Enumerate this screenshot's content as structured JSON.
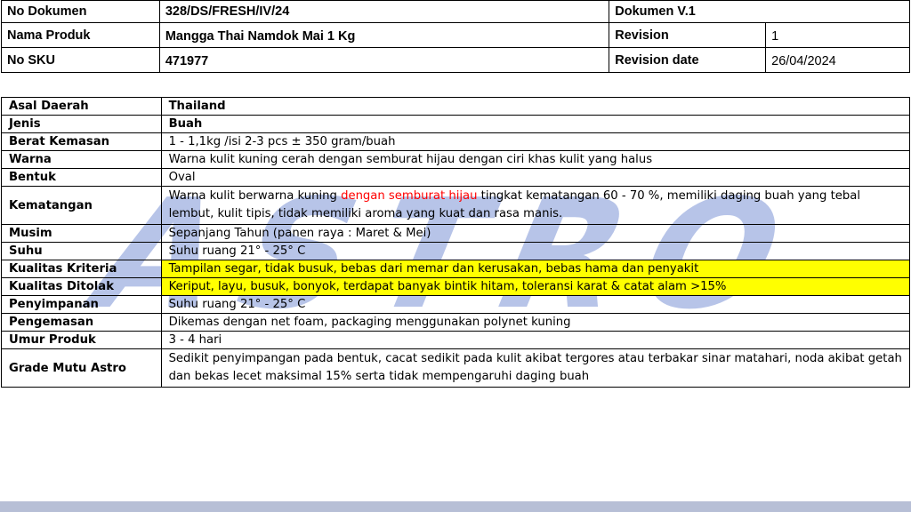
{
  "header": {
    "no_dokumen_label": "No Dokumen",
    "no_dokumen_value": "328/DS/FRESH/IV/24",
    "dokumen_version": "Dokumen V.1",
    "nama_produk_label": "Nama Produk",
    "nama_produk_value": "Mangga Thai Namdok Mai 1 Kg",
    "revision_label": "Revision",
    "revision_value": "1",
    "no_sku_label": "No SKU",
    "no_sku_value": "471977",
    "revision_date_label": "Revision date",
    "revision_date_value": "26/04/2024"
  },
  "spec": {
    "asal_daerah": {
      "label": "Asal Daerah",
      "value": "Thailand"
    },
    "jenis": {
      "label": "Jenis",
      "value": "Buah"
    },
    "berat_kemasan": {
      "label": "Berat Kemasan",
      "value": "1 - 1,1kg /isi 2-3 pcs  ± 350 gram/buah"
    },
    "warna": {
      "label": "Warna",
      "value": "Warna kulit kuning cerah dengan semburat hijau dengan ciri khas kulit yang halus"
    },
    "bentuk": {
      "label": "Bentuk",
      "value": "Oval"
    },
    "kematangan": {
      "label": "Kematangan",
      "value_part1": "Warna kulit berwarna kuning ",
      "value_red": "dengan semburat hijau",
      "value_part2": "  tingkat kematangan 60 - 70 %, memiliki daging buah yang tebal lembut, kulit tipis, tidak memiliki aroma yang kuat dan rasa manis."
    },
    "musim": {
      "label": "Musim",
      "value": "Sepanjang Tahun (panen raya : Maret & Mei)"
    },
    "suhu": {
      "label": "Suhu",
      "value": "Suhu ruang  21° - 25° C"
    },
    "kualitas_kriteria": {
      "label": "Kualitas Kriteria",
      "value": "Tampilan segar, tidak busuk, bebas dari memar dan kerusakan, bebas hama dan penyakit"
    },
    "kualitas_ditolak": {
      "label": "Kualitas Ditolak",
      "value": "Keriput, layu, busuk, bonyok, terdapat banyak bintik hitam, toleransi karat & catat alam >15%"
    },
    "penyimpanan": {
      "label": "Penyimpanan",
      "value": "Suhu ruang  21° - 25° C"
    },
    "pengemasan": {
      "label": "Pengemasan",
      "value": "Dikemas dengan net foam, packaging menggunakan polynet kuning"
    },
    "umur_produk": {
      "label": "Umur Produk",
      "value": "3 - 4 hari"
    },
    "grade_mutu": {
      "label": "Grade Mutu Astro",
      "value": "Sedikit penyimpangan pada bentuk, cacat sedikit pada kulit akibat tergores atau terbakar sinar matahari, noda akibat getah dan bekas lecet maksimal 15% serta tidak mempengaruhi daging buah"
    }
  },
  "watermark": {
    "text": "ASTRO",
    "color": "#7b93d6"
  },
  "colors": {
    "highlight": "#ffff00",
    "accent_red": "#ff0000",
    "bottom_bar": "#b7bfd6"
  }
}
